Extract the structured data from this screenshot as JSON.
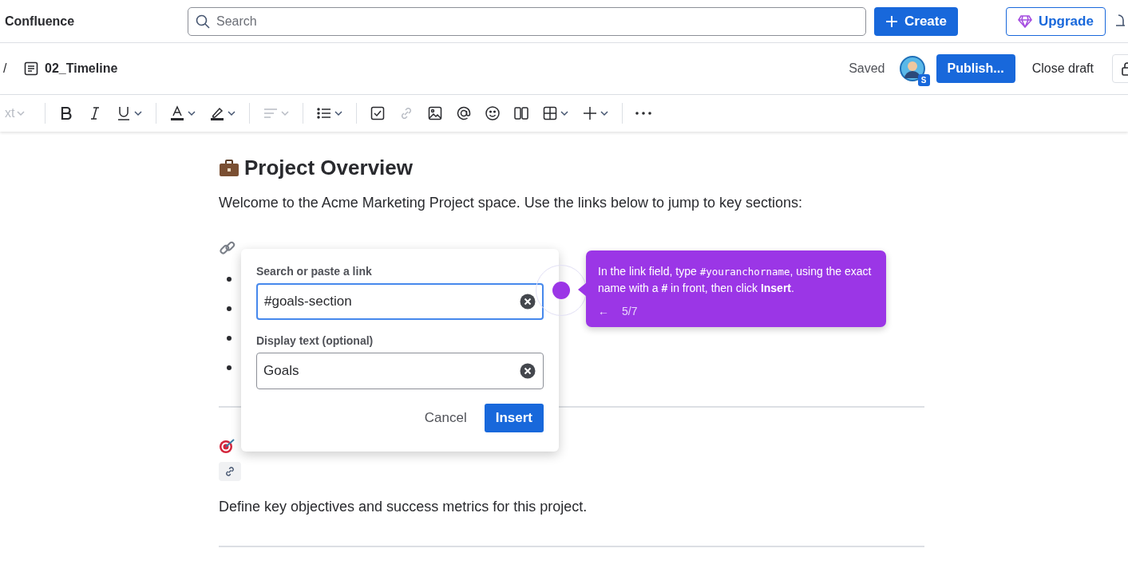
{
  "topbar": {
    "app_name": "Confluence",
    "search": {
      "placeholder": "Search"
    },
    "create_label": "Create",
    "upgrade_label": "Upgrade"
  },
  "pagebar": {
    "separator": "/",
    "page_title": "02_Timeline",
    "status": "Saved",
    "avatar_badge": "S",
    "publish_label": "Publish...",
    "close_label": "Close draft"
  },
  "toolbar": [
    [
      {
        "kind": "text-style",
        "label": "xt",
        "dropdown": true,
        "disabled": true
      }
    ],
    [
      {
        "kind": "bold",
        "dropdown": false,
        "disabled": false
      },
      {
        "kind": "italic",
        "dropdown": false,
        "disabled": false
      },
      {
        "kind": "underline",
        "dropdown": true,
        "disabled": false
      }
    ],
    [
      {
        "kind": "text-color",
        "dropdown": true,
        "disabled": false
      },
      {
        "kind": "highlight",
        "dropdown": true,
        "disabled": false
      }
    ],
    [
      {
        "kind": "align",
        "dropdown": true,
        "disabled": true
      }
    ],
    [
      {
        "kind": "list",
        "dropdown": true,
        "disabled": false
      }
    ],
    [
      {
        "kind": "task",
        "dropdown": false,
        "disabled": false
      },
      {
        "kind": "link",
        "dropdown": false,
        "disabled": true
      },
      {
        "kind": "image",
        "dropdown": false,
        "disabled": false
      },
      {
        "kind": "mention",
        "dropdown": false,
        "disabled": false
      },
      {
        "kind": "emoji",
        "dropdown": false,
        "disabled": false
      },
      {
        "kind": "columns",
        "dropdown": false,
        "disabled": false
      },
      {
        "kind": "table",
        "dropdown": true,
        "disabled": false
      },
      {
        "kind": "insert",
        "dropdown": true,
        "disabled": false
      }
    ],
    [
      {
        "kind": "more",
        "dropdown": false,
        "disabled": false
      }
    ]
  ],
  "document": {
    "title": "Project Overview",
    "intro": "Welcome to the Acme Marketing Project space. Use the links below to jump to key sections:",
    "goals_text": "Define key objectives and success metrics for this project."
  },
  "link_dialog": {
    "link_label": "Search or paste a link",
    "link_value": "#goals-section",
    "display_label": "Display text (optional)",
    "display_value": "Goals",
    "cancel_label": "Cancel",
    "insert_label": "Insert"
  },
  "tour_tip": {
    "text_before": "In the link field, type ",
    "code": "#youranchorname",
    "text_after": ", using the exact name with a **#** in front, then click **Insert**.",
    "back_label": "←",
    "progress": "5/7"
  }
}
